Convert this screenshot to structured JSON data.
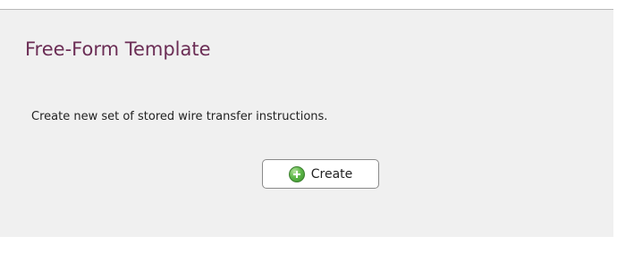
{
  "panel": {
    "title": "Free-Form Template",
    "description": "Create new set of stored wire transfer instructions.",
    "create_button": {
      "label": "Create",
      "icon": "plus-circle-icon"
    }
  },
  "colors": {
    "title": "#6b2d55",
    "panel_background": "#f0f0f0",
    "icon_green": "#5fb84a"
  }
}
